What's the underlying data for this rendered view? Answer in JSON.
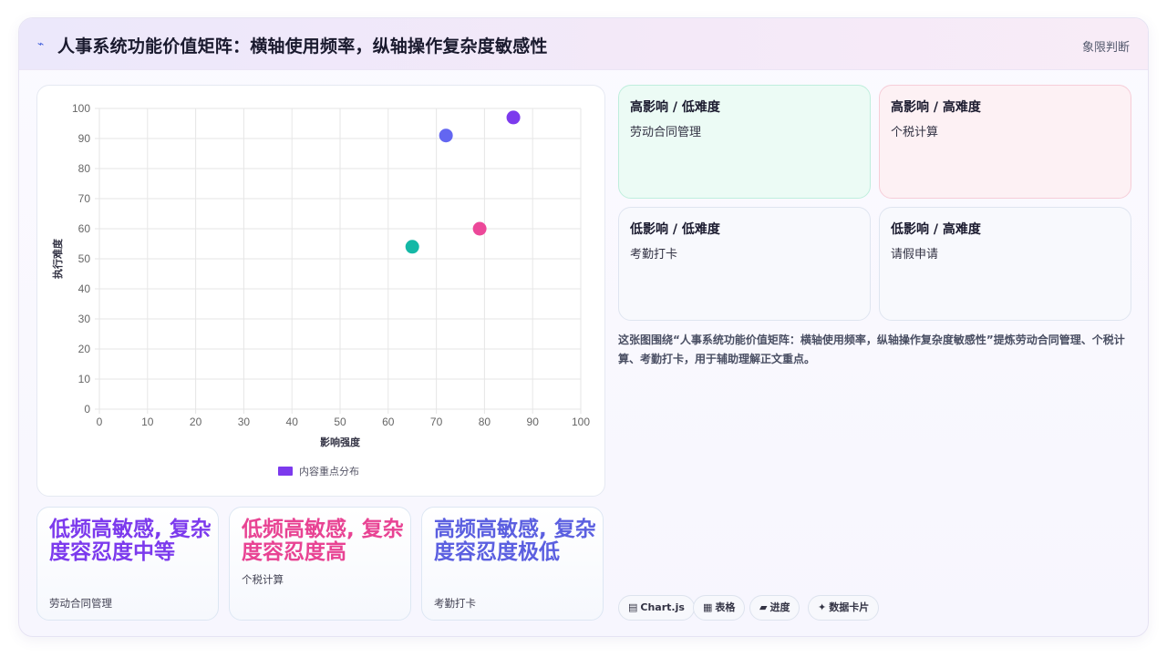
{
  "header": {
    "icon": "lightning-icon",
    "title": "人事系统功能价值矩阵：横轴使用频率，纵轴操作复杂度敏感性",
    "tag": "象限判断"
  },
  "chart_data": {
    "type": "scatter",
    "title": "",
    "xlabel": "影响强度",
    "ylabel": "执行难度",
    "xlim": [
      0,
      100
    ],
    "ylim": [
      0,
      100
    ],
    "xticks": [
      0,
      10,
      20,
      30,
      40,
      50,
      60,
      70,
      80,
      90,
      100
    ],
    "yticks": [
      0,
      10,
      20,
      30,
      40,
      50,
      60,
      70,
      80,
      90,
      100
    ],
    "grid": true,
    "legend_position": "bottom",
    "series": [
      {
        "name": "内容重点分布",
        "color": "#7c3aed",
        "points": [
          {
            "x": 72,
            "y": 91,
            "color": "#6366f1"
          },
          {
            "x": 86,
            "y": 97,
            "color": "#7c3aed"
          },
          {
            "x": 79,
            "y": 60,
            "color": "#ec4899"
          },
          {
            "x": 65,
            "y": 54,
            "color": "#14b8a6"
          }
        ]
      }
    ]
  },
  "stat_cards": [
    {
      "headline": "低频高敏感, 复杂度容忍度中等",
      "label": "劳动合同管理",
      "color": "#7c3aed"
    },
    {
      "headline": "低频高敏感, 复杂度容忍度高",
      "label": "个税计算",
      "color": "#e84393"
    },
    {
      "headline": "高频高敏感, 复杂度容忍度极低",
      "label": "考勤打卡",
      "color": "#5b5fe0"
    }
  ],
  "quadrants": {
    "high_impact_low_difficulty": {
      "title": "高影响 / 低难度",
      "item": "劳动合同管理"
    },
    "high_impact_high_difficulty": {
      "title": "高影响 / 高难度",
      "item": "个税计算"
    },
    "low_impact_low_difficulty": {
      "title": "低影响 / 低难度",
      "item": "考勤打卡"
    },
    "low_impact_high_difficulty": {
      "title": "低影响 / 高难度",
      "item": "请假申请"
    }
  },
  "note": "这张图围绕“人事系统功能价值矩阵：横轴使用频率，纵轴操作复杂度敏感性”提炼劳动合同管理、个税计算、考勤打卡，用于辅助理解正文重点。",
  "tools": [
    {
      "icon": "▤",
      "label": "Chart.js"
    },
    {
      "icon": "▦",
      "label": "表格"
    },
    {
      "icon": "▰",
      "label": "进度"
    },
    {
      "icon": "✦",
      "label": "数据卡片"
    }
  ]
}
